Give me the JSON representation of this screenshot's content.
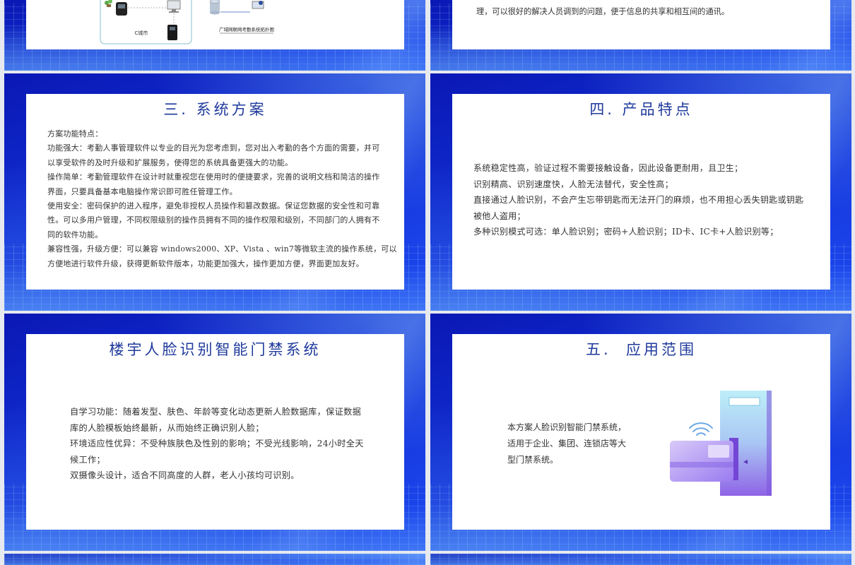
{
  "colors": {
    "slide_bg": "#1230d6",
    "card_bg": "#ffffff",
    "title": "#1f3a9c",
    "body_text": "#333333",
    "illustration_cyan": "#bdeef8",
    "illustration_purple": "#8f63e6"
  },
  "slides": [
    {
      "diagram": {
        "city_label": "C城市",
        "caption": "广域网联网考勤系统拓扑图"
      }
    },
    {
      "lines": [
        "理，可以很好的解决人员调到的问题，便于信息的共享和相互间的通讯。"
      ]
    },
    {
      "title": "三. 系统方案",
      "lines": [
        "方案功能特点：",
        "功能强大：考勤人事管理软件以专业的目光为您考虑到，您对出入考勤的各个方面的需要，并可",
        "以享受软件的及时升级和扩展服务，使得您的系统具备更强大的功能。",
        "操作简单：考勤管理软件在设计时就重视您在使用时的便捷要求，完善的说明文档和简洁的操作",
        "界面，只要具备基本电脑操作常识即可胜任管理工作。",
        "使用安全：密码保护的进入程序，避免非授权人员操作和篡改数据。保证您数据的安全性和可靠",
        "性。可以多用户管理，不同权限级别的操作员拥有不同的操作权限和级别，不同部门的人拥有不",
        "同的软件功能。",
        "兼容性强，升级方便：可以兼容 windows2000、XP、Vista 、win7等微软主流的操作系统，可以",
        "方便地进行软件升级，获得更新软件版本，功能更加强大，操作更加方便，界面更加友好。"
      ]
    },
    {
      "title": "四. 产品特点",
      "lines": [
        "系统稳定性高，验证过程不需要接触设备，因此设备更耐用，且卫生；",
        "识别精高、识别速度快，人脸无法替代，安全性高；",
        "直接通过人脸识别，不会产生忘带钥匙而无法开门的麻烦，也不用担心丢失钥匙或钥匙",
        "被他人盗用；",
        "多种识别模式可选：单人脸识别；密码+人脸识别；ID卡、IC卡+人脸识别等；"
      ]
    },
    {
      "title": "楼宇人脸识别智能门禁系统",
      "lines": [
        "自学习功能：随着发型、肤色、年龄等变化动态更新人脸数据库，保证数据",
        "库的人脸模板始终最新，从而始终正确识别人脸；",
        "环境适应性优异：不受种族肤色及性别的影响；不受光线影响，24小时全天",
        "候工作；",
        "双摄像头设计，适合不同高度的人群，老人小孩均可识别。"
      ]
    },
    {
      "title": "五.  应用范围",
      "lines": [
        "本方案人脸识别智能门禁系统，",
        "适用于企业、集团、连锁店等大",
        "型门禁系统。"
      ],
      "illustration": "access-control-door-card-icon"
    }
  ]
}
